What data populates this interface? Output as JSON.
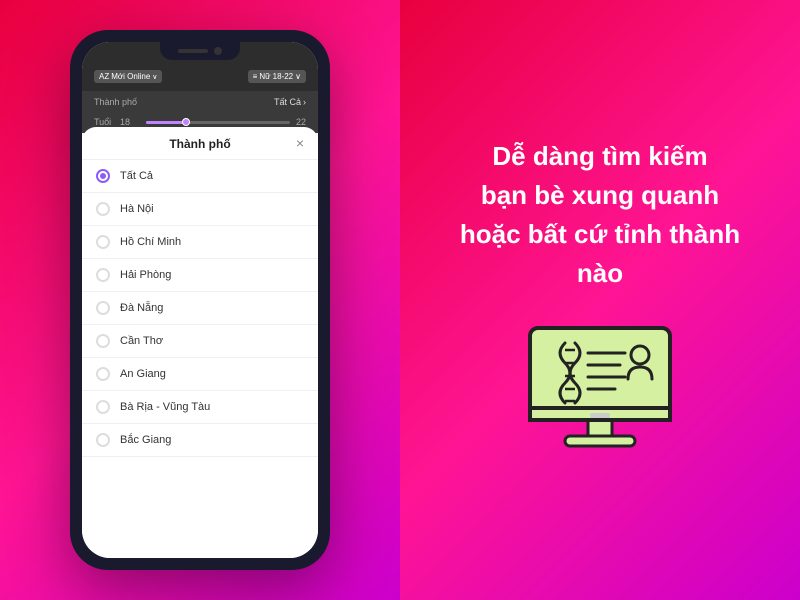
{
  "left": {
    "phone": {
      "topbar": {
        "badge1": "Mới Online",
        "badge2": "Nữ 18-22"
      },
      "filter": {
        "label": "Thành phố",
        "value": "Tất Cả"
      },
      "slider": {
        "label": "Tuổi",
        "min": "18",
        "max": "22"
      },
      "modal": {
        "title": "Thành phố",
        "close": "×",
        "cities": [
          {
            "name": "Tất Cả",
            "selected": true
          },
          {
            "name": "Hà Nội",
            "selected": false
          },
          {
            "name": "Hồ Chí Minh",
            "selected": false
          },
          {
            "name": "Hải Phòng",
            "selected": false
          },
          {
            "name": "Đà Nẵng",
            "selected": false
          },
          {
            "name": "Cần Thơ",
            "selected": false
          },
          {
            "name": "An Giang",
            "selected": false
          },
          {
            "name": "Bà Rịa - Vũng Tàu",
            "selected": false
          },
          {
            "name": "Bắc Giang",
            "selected": false
          }
        ]
      }
    }
  },
  "right": {
    "heading_line1": "Dễ dàng tìm kiếm",
    "heading_line2": "bạn bè xung quanh",
    "heading_line3": "hoặc bất cứ tỉnh thành nào"
  }
}
